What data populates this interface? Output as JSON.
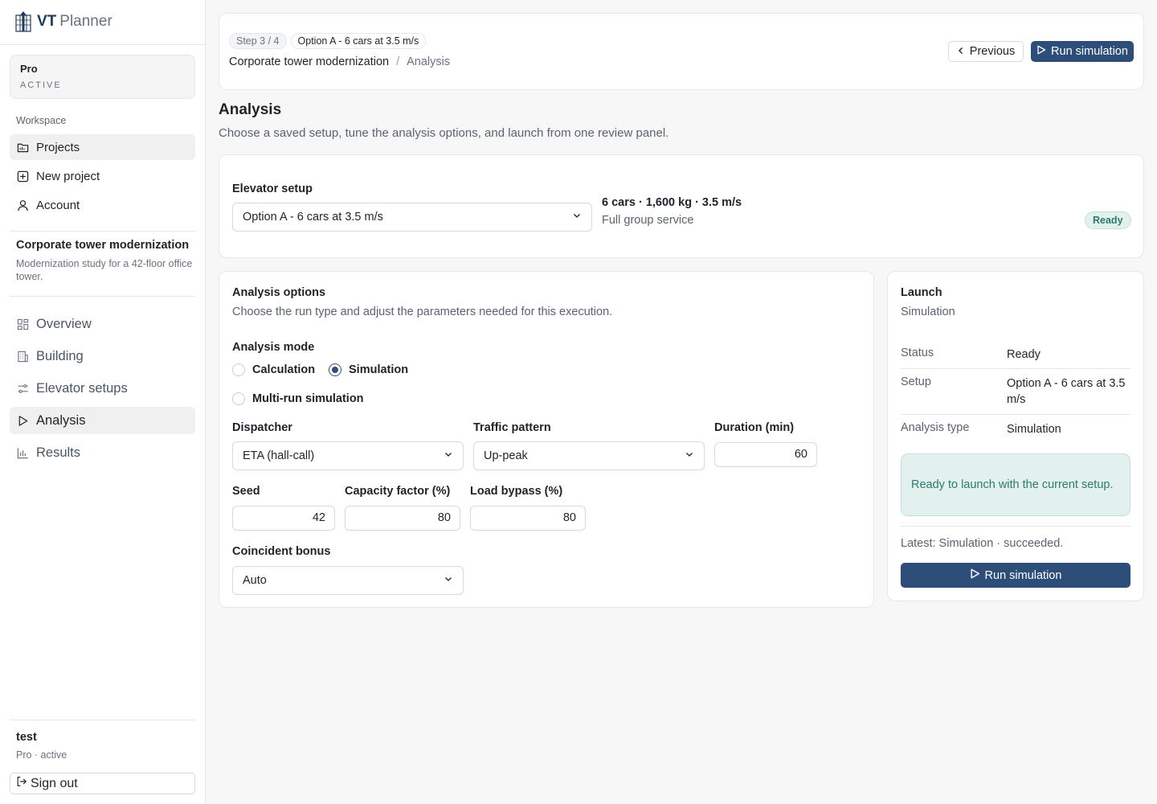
{
  "brand": {
    "vt": "VT",
    "planner": "Planner"
  },
  "plan": {
    "name": "Pro",
    "status": "ACTIVE"
  },
  "sidebar": {
    "workspace_label": "Workspace",
    "workspace_items": [
      {
        "label": "Projects",
        "icon": "folder-icon"
      },
      {
        "label": "New project",
        "icon": "plus-square-icon"
      },
      {
        "label": "Account",
        "icon": "user-icon"
      }
    ],
    "project": {
      "title": "Corporate tower modernization",
      "description": "Modernization study for a 42-floor office tower."
    },
    "project_items": [
      {
        "label": "Overview",
        "icon": "grid-icon"
      },
      {
        "label": "Building",
        "icon": "building-icon"
      },
      {
        "label": "Elevator setups",
        "icon": "sliders-icon"
      },
      {
        "label": "Analysis",
        "icon": "play-icon"
      },
      {
        "label": "Results",
        "icon": "bar-chart-icon"
      }
    ],
    "user": {
      "name": "test",
      "sub": "Pro · active"
    },
    "sign_out": "Sign out"
  },
  "header": {
    "step": "Step 3 / 4",
    "setup_chip": "Option A - 6 cars at 3.5 m/s",
    "breadcrumb_project": "Corporate tower modernization",
    "breadcrumb_sep": "/",
    "breadcrumb_current": "Analysis",
    "previous": "Previous",
    "run": "Run simulation"
  },
  "page": {
    "title": "Analysis",
    "subtitle": "Choose a saved setup, tune the analysis options, and launch from one review panel."
  },
  "setup": {
    "label": "Elevator setup",
    "selected": "Option A - 6 cars at 3.5 m/s",
    "summary": "6 cars · 1,600 kg · 3.5 m/s",
    "service": "Full group service",
    "badge": "Ready"
  },
  "options": {
    "title": "Analysis options",
    "subtitle": "Choose the run type and adjust the parameters needed for this execution.",
    "mode_label": "Analysis mode",
    "modes": [
      "Calculation",
      "Simulation",
      "Multi-run simulation"
    ],
    "dispatcher_label": "Dispatcher",
    "dispatcher": "ETA (hall-call)",
    "traffic_label": "Traffic pattern",
    "traffic": "Up-peak",
    "duration_label": "Duration (min)",
    "duration": "60",
    "seed_label": "Seed",
    "seed": "42",
    "capacity_label": "Capacity factor (%)",
    "capacity": "80",
    "bypass_label": "Load bypass (%)",
    "bypass": "80",
    "coincident_label": "Coincident bonus",
    "coincident": "Auto"
  },
  "launch": {
    "title": "Launch",
    "subtitle": "Simulation",
    "rows": [
      {
        "k": "Status",
        "v": "Ready"
      },
      {
        "k": "Setup",
        "v": "Option A - 6 cars at 3.5 m/s"
      },
      {
        "k": "Analysis type",
        "v": "Simulation"
      }
    ],
    "notice": "Ready to launch with the current setup.",
    "latest": "Latest: Simulation · succeeded.",
    "run": "Run simulation"
  },
  "colors": {
    "accent": "#2d4e78",
    "ready_bg": "#e3f1ee",
    "ready_text": "#2c7a6b"
  }
}
